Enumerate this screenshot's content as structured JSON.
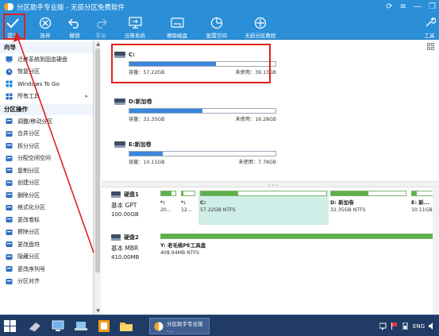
{
  "window": {
    "title": "分区助手专业版 - 无损分区免费软件",
    "controls": [
      "⟳",
      "≡",
      "—",
      "❐"
    ]
  },
  "toolbar": {
    "buttons": [
      {
        "label": "提交",
        "icon": "check-icon"
      },
      {
        "label": "放弃",
        "icon": "discard-icon"
      },
      {
        "label": "撤销",
        "icon": "undo-icon"
      },
      {
        "label": "重做",
        "icon": "redo-icon"
      },
      {
        "label": "迁移系统",
        "icon": "migrate-os-icon"
      },
      {
        "label": "擦除磁盘",
        "icon": "wipe-disk-icon"
      },
      {
        "label": "配置空间",
        "icon": "allocate-space-icon"
      },
      {
        "label": "无损分区教程",
        "icon": "tutorial-icon"
      },
      {
        "label": "工具",
        "icon": "tools-icon"
      }
    ]
  },
  "sidebar": {
    "wizard_title": "向导",
    "wizard_items": [
      {
        "label": "迁移系统到固态硬盘",
        "icon": "migrate-icon",
        "color": "#2f6fc0"
      },
      {
        "label": "恢复分区",
        "icon": "restore-icon",
        "color": "#2f6fc0"
      },
      {
        "label": "Windows To Go",
        "icon": "windows-icon",
        "color": "#1e88e5"
      },
      {
        "label": "所有工具",
        "icon": "all-tools-icon",
        "color": "#2f6fc0"
      }
    ],
    "ops_title": "分区操作",
    "ops_items": [
      {
        "label": "调整/移动分区",
        "icon": "resize-icon",
        "color": "#2f6fc0"
      },
      {
        "label": "合并分区",
        "icon": "merge-icon",
        "color": "#2f6fc0"
      },
      {
        "label": "拆分分区",
        "icon": "split-icon",
        "color": "#2f6fc0"
      },
      {
        "label": "分配空闲空间",
        "icon": "allocate-icon",
        "color": "#2f6fc0"
      },
      {
        "label": "复制分区",
        "icon": "copy-icon",
        "color": "#2f6fc0"
      },
      {
        "label": "创建分区",
        "icon": "create-icon",
        "color": "#2f6fc0"
      },
      {
        "label": "删除分区",
        "icon": "delete-icon",
        "color": "#2f6fc0"
      },
      {
        "label": "格式化分区",
        "icon": "format-icon",
        "color": "#2f6fc0"
      },
      {
        "label": "更改卷标",
        "icon": "label-icon",
        "color": "#2f6fc0"
      },
      {
        "label": "擦除分区",
        "icon": "wipe-icon",
        "color": "#2f6fc0"
      },
      {
        "label": "更改盘符",
        "icon": "drive-letter-icon",
        "color": "#2f6fc0"
      },
      {
        "label": "隐藏分区",
        "icon": "hide-icon",
        "color": "#2f6fc0"
      },
      {
        "label": "更改序列号",
        "icon": "serial-icon",
        "color": "#2f6fc0"
      },
      {
        "label": "分区对齐",
        "icon": "align-icon",
        "color": "#2f6fc0"
      }
    ]
  },
  "partitions": [
    {
      "name": "C:",
      "used_fraction": 0.59,
      "capacity": "容量：57.22GB",
      "unused": "未使用：39.13GB"
    },
    {
      "name": "D:新加卷",
      "used_fraction": 0.5,
      "capacity": "容量：32.35GB",
      "unused": "未使用：16.28GB"
    },
    {
      "name": "E:新加卷",
      "used_fraction": 0.23,
      "capacity": "容量：10.11GB",
      "unused": "未使用：7.78GB"
    }
  ],
  "disks": [
    {
      "name": "硬盘1",
      "type": "基本 GPT",
      "size": "100.00GB",
      "parts": [
        {
          "name": "*:",
          "size": "20...",
          "fill": 0.7
        },
        {
          "name": "*:",
          "size": "12...",
          "fill": 0.1
        },
        {
          "name": "C:",
          "size": "57.22GB NTFS",
          "fill": 0.3,
          "selected": true
        },
        {
          "name": "D: 新加卷",
          "size": "32.35GB NTFS",
          "fill": 0.5
        },
        {
          "name": "E: 新...",
          "size": "10.11GB...",
          "fill": 0.22
        }
      ]
    },
    {
      "name": "硬盘2",
      "type": "基本 MBR",
      "size": "410.00MB",
      "parts": [
        {
          "name": "Y: 老毛桃PE工具盘",
          "size": "408.94MB NTFS",
          "fill": 0.99
        }
      ]
    }
  ],
  "taskbar": {
    "active_task_label": "分区助手专业版 -...",
    "ime_label": "ENG"
  },
  "colors": {
    "titlebar": "#2b8fd8",
    "accent_bar": "#3b86dd",
    "disk_bar": "#5db04b",
    "highlight": "#e02020"
  }
}
